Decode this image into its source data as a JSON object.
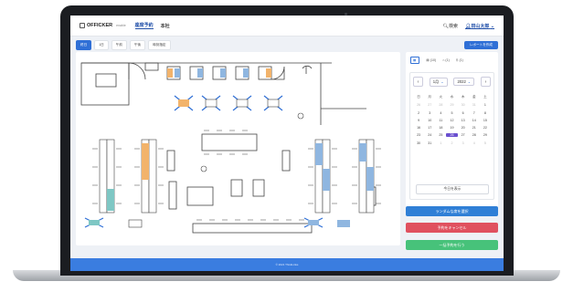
{
  "header": {
    "logo": "OFFICKER",
    "logo_tag": "enable",
    "nav": [
      {
        "label": "座席予約"
      },
      {
        "label": "本社"
      }
    ],
    "search": "検索",
    "user": "田山太郎"
  },
  "subtabs": [
    {
      "label": "終日"
    },
    {
      "label": "1日"
    },
    {
      "label": "午前"
    },
    {
      "label": "午後"
    },
    {
      "label": "時刻指定"
    }
  ],
  "subtab_active_index": 0,
  "top_right_button": "レポートを作成",
  "panel": {
    "tab_counts": [
      {
        "icon": "calendar-icon",
        "count": ""
      },
      {
        "icon": "document-icon",
        "count": "(10)"
      },
      {
        "icon": "home-icon",
        "count": "(1)"
      },
      {
        "icon": "pin-icon",
        "count": "(1)"
      }
    ],
    "calendar": {
      "month": "1月",
      "year": "2022",
      "weekdays": [
        "日",
        "月",
        "火",
        "水",
        "木",
        "金",
        "土"
      ],
      "days": [
        [
          "26",
          "27",
          "28",
          "29",
          "30",
          "31",
          "1"
        ],
        [
          "2",
          "3",
          "4",
          "5",
          "6",
          "7",
          "8"
        ],
        [
          "9",
          "10",
          "11",
          "12",
          "13",
          "14",
          "15"
        ],
        [
          "16",
          "17",
          "18",
          "19",
          "20",
          "21",
          "22"
        ],
        [
          "23",
          "24",
          "25",
          "26",
          "27",
          "28",
          "29"
        ],
        [
          "30",
          "31",
          "1",
          "2",
          "3",
          "4",
          "5"
        ]
      ],
      "selected_day": "26",
      "today_button": "今日を表示"
    }
  },
  "actions": {
    "random": "ランダムな席を選択",
    "cancel": "予約をキャンセル",
    "bulk": "一括予約を行う"
  },
  "footer": "© 2021 ThinkLinks",
  "colors": {
    "primary": "#2f6fd6",
    "cancel": "#e0515f",
    "bulk": "#47c27a",
    "selected_day": "#6a4fcf",
    "seat_orange": "#f2b36b",
    "seat_blue": "#8fb6e0",
    "seat_teal": "#7ec7c4",
    "footer": "#3a7de0"
  }
}
